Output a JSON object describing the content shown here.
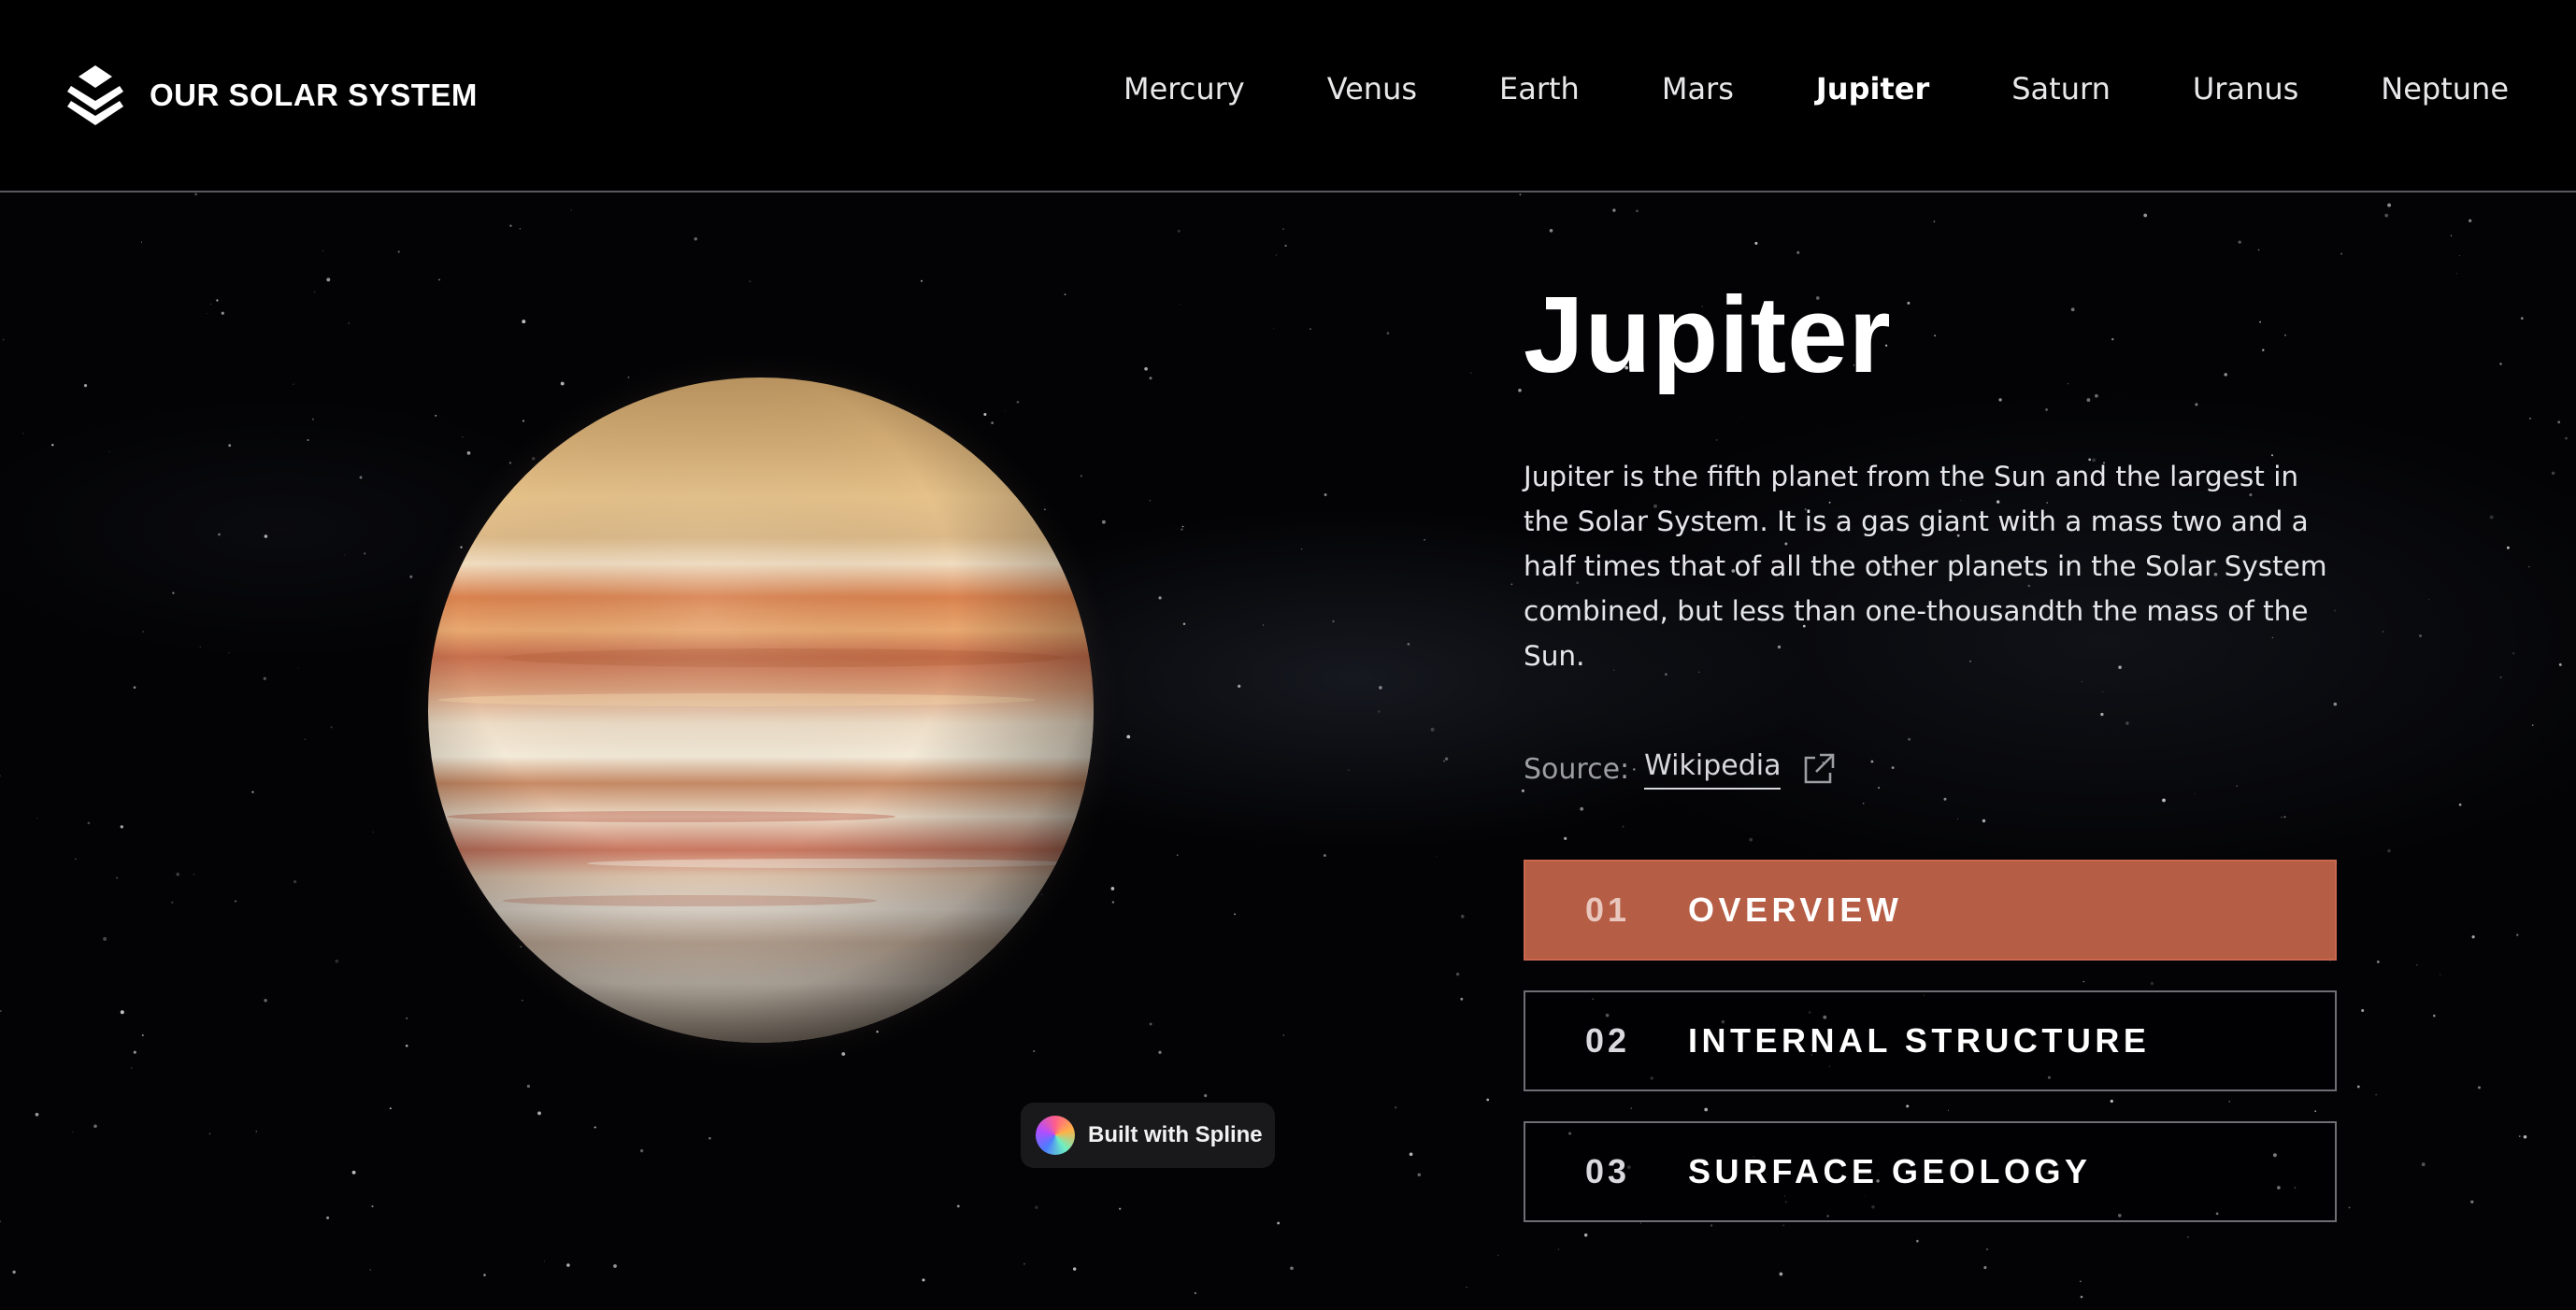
{
  "brand": {
    "name": "OUR SOLAR SYSTEM",
    "icon": "layered-diamond-logo-icon"
  },
  "nav": {
    "items": [
      {
        "label": "Mercury",
        "active": false
      },
      {
        "label": "Venus",
        "active": false
      },
      {
        "label": "Earth",
        "active": false
      },
      {
        "label": "Mars",
        "active": false
      },
      {
        "label": "Jupiter",
        "active": true
      },
      {
        "label": "Saturn",
        "active": false
      },
      {
        "label": "Uranus",
        "active": false
      },
      {
        "label": "Neptune",
        "active": false
      }
    ]
  },
  "planet": {
    "name": "Jupiter",
    "description": "Jupiter is the fifth planet from the Sun and the largest in the Solar System. It is a gas giant with a mass two and a half times that of all the other planets in the Solar System combined, but less than one-thousandth the mass of the Sun.",
    "source_label": "Source:",
    "source_link": "Wikipedia",
    "source_icon": "external-link-icon"
  },
  "tabs": [
    {
      "num": "01",
      "label": "OVERVIEW",
      "active": true
    },
    {
      "num": "02",
      "label": "INTERNAL STRUCTURE",
      "active": false
    },
    {
      "num": "03",
      "label": "SURFACE GEOLOGY",
      "active": false
    }
  ],
  "badge": {
    "label": "Built with Spline"
  },
  "colors": {
    "background": "#000000",
    "accent": "#b65d45",
    "tab_border": "#6e6e75",
    "text_muted": "#9d9da4"
  }
}
